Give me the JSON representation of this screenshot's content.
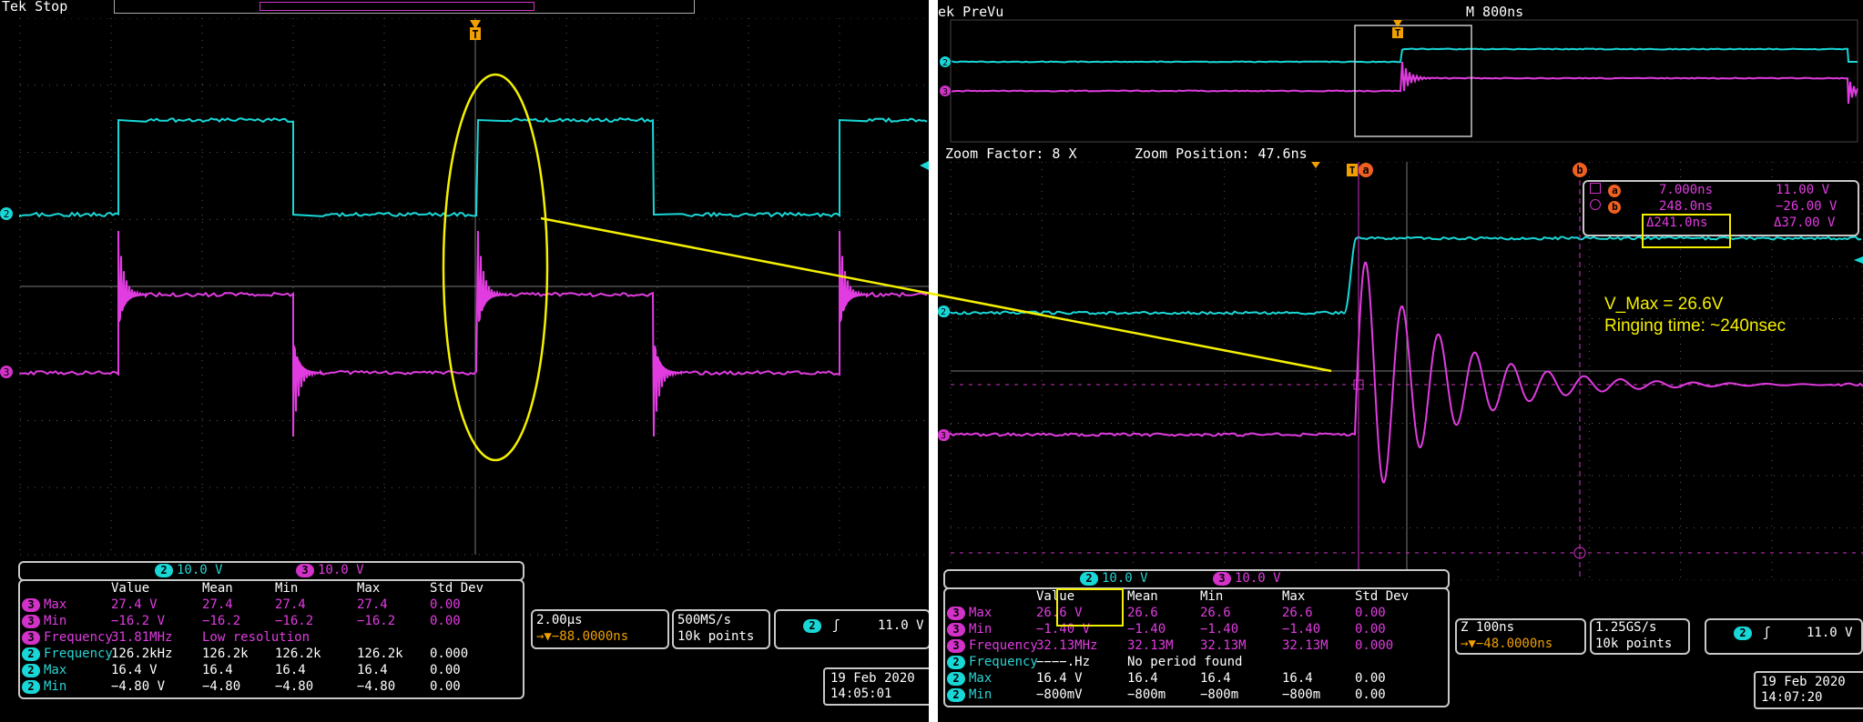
{
  "left": {
    "title": "Tek Stop",
    "channel_scales": [
      {
        "ch": "2",
        "value": "10.0 V"
      },
      {
        "ch": "3",
        "value": "10.0 V"
      }
    ],
    "meas_headers": [
      "Value",
      "Mean",
      "Min",
      "Max",
      "Std Dev"
    ],
    "meas_rows": [
      {
        "ch": "3",
        "name": "Max",
        "cells": [
          "27.4 V",
          "27.4",
          "27.4",
          "27.4",
          "0.00"
        ]
      },
      {
        "ch": "3",
        "name": "Min",
        "cells": [
          "−16.2 V",
          "−16.2",
          "−16.2",
          "−16.2",
          "0.00"
        ]
      },
      {
        "ch": "3",
        "name": "Frequency",
        "cells": [
          "31.81MHz",
          "Low resolution",
          "",
          "",
          ""
        ]
      },
      {
        "ch": "2",
        "name": "Frequency",
        "cells": [
          "126.2kHz",
          "126.2k",
          "126.2k",
          "126.2k",
          "0.000"
        ]
      },
      {
        "ch": "2",
        "name": "Max",
        "cells": [
          "16.4 V",
          "16.4",
          "16.4",
          "16.4",
          "0.00"
        ]
      },
      {
        "ch": "2",
        "name": "Min",
        "cells": [
          "−4.80 V",
          "−4.80",
          "−4.80",
          "−4.80",
          "0.00"
        ]
      }
    ],
    "timebase": "2.00µs",
    "trigger_pos": "→▼−88.0000ns",
    "sample_rate": "500MS/s",
    "record_length": "10k points",
    "trigger_ch": "2",
    "trigger_level": "11.0 V",
    "date": "19 Feb 2020",
    "time": "14:05:01"
  },
  "right": {
    "title": "ek PreVu",
    "main_timebase": "M 800ns",
    "zoom_factor": "Zoom Factor: 8 X",
    "zoom_position": "Zoom Position: 47.6ns",
    "cursor_a_time": "7.000ns",
    "cursor_a_volt": "11.00 V",
    "cursor_b_time": "248.0ns",
    "cursor_b_volt": "−26.00 V",
    "delta_time": "Δ241.0ns",
    "delta_volt": "Δ37.00 V",
    "annotation_line1": "V_Max = 26.6V",
    "annotation_line2": "Ringing time: ~240nsec",
    "channel_scales": [
      {
        "ch": "2",
        "value": "10.0 V"
      },
      {
        "ch": "3",
        "value": "10.0 V"
      }
    ],
    "meas_headers": [
      "Value",
      "Mean",
      "Min",
      "Max",
      "Std Dev"
    ],
    "meas_rows": [
      {
        "ch": "3",
        "name": "Max",
        "cells": [
          "26.6 V",
          "26.6",
          "26.6",
          "26.6",
          "0.00"
        ]
      },
      {
        "ch": "3",
        "name": "Min",
        "cells": [
          "−1.40 V",
          "−1.40",
          "−1.40",
          "−1.40",
          "0.00"
        ]
      },
      {
        "ch": "3",
        "name": "Frequency",
        "cells": [
          "32.13MHz",
          "32.13M",
          "32.13M",
          "32.13M",
          "0.000"
        ]
      },
      {
        "ch": "2",
        "name": "Frequency",
        "cells": [
          "−−−−.Hz",
          "No period found",
          "",
          "",
          ""
        ]
      },
      {
        "ch": "2",
        "name": "Max",
        "cells": [
          "16.4 V",
          "16.4",
          "16.4",
          "16.4",
          "0.00"
        ]
      },
      {
        "ch": "2",
        "name": "Min",
        "cells": [
          "−800mV",
          "−800m",
          "−800m",
          "−800m",
          "0.00"
        ]
      }
    ],
    "zoom_timebase": "Z 100ns",
    "trigger_pos": "→▼−48.0000ns",
    "sample_rate": "1.25GS/s",
    "record_length": "10k points",
    "trigger_ch": "2",
    "trigger_level": "11.0 V",
    "date": "19 Feb 2020",
    "time": "14:07:20"
  },
  "markers": {
    "ch2": "2",
    "ch3": "3",
    "trigger": "T",
    "cursor_a": "a",
    "cursor_b": "b"
  },
  "colors": {
    "ch2": "#19d7d7",
    "ch3": "#e03ce0",
    "annotation": "#f5f000",
    "grid": "#5a5a5a"
  }
}
